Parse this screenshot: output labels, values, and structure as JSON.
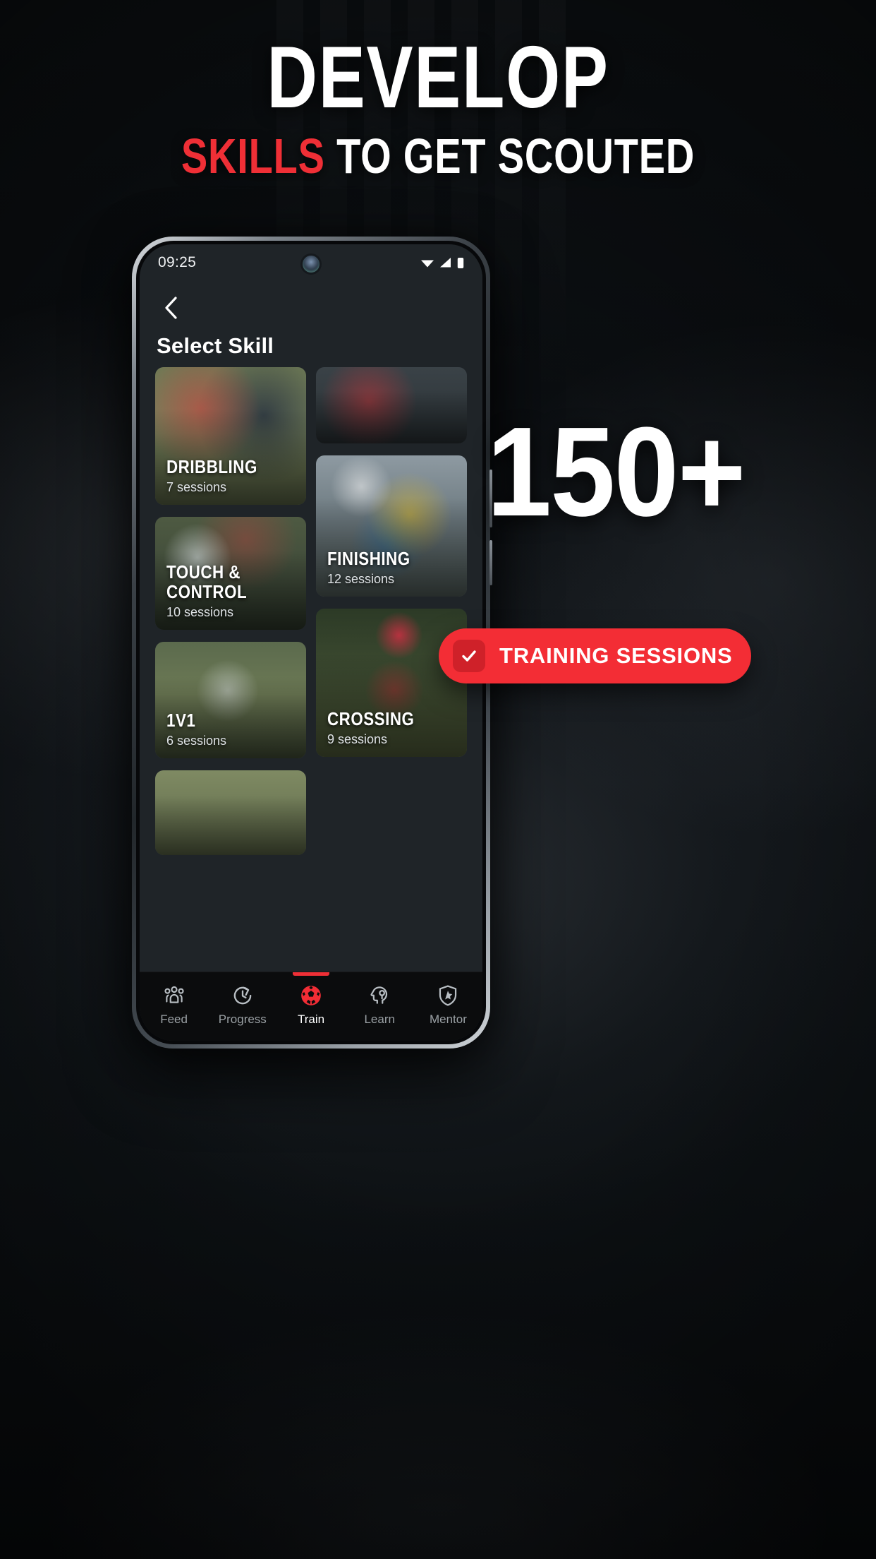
{
  "promo": {
    "headline": "DEVELOP",
    "subhead_highlight": "SKILLS",
    "subhead_rest": "TO GET SCOUTED",
    "accent_color": "#ef2f36",
    "stat_number": "150+",
    "badge_label": "TRAINING SESSIONS",
    "badge_color": "#f32d35"
  },
  "phone": {
    "status_bar": {
      "time": "09:25",
      "icons": [
        "wifi-icon",
        "signal-icon",
        "battery-icon"
      ]
    },
    "app": {
      "back_icon": "chevron-left-icon",
      "title": "Select Skill",
      "left_column": [
        {
          "title": "DRIBBLING",
          "sessions": "7 sessions",
          "art": "ph-dribbling"
        },
        {
          "title": "TOUCH &\nCONTROL",
          "sessions": "10 sessions",
          "art": "ph-touch"
        },
        {
          "title": "1V1",
          "sessions": "6 sessions",
          "art": "ph-1v1"
        },
        {
          "title": "",
          "sessions": "",
          "art": "ph-bottomleft"
        }
      ],
      "right_column": [
        {
          "title": "",
          "sessions": "",
          "art": "ph-top-right"
        },
        {
          "title": "FINISHING",
          "sessions": "12 sessions",
          "art": "ph-finishing"
        },
        {
          "title": "CROSSING",
          "sessions": "9 sessions",
          "art": "ph-crossing"
        }
      ],
      "nav": [
        {
          "label": "Feed",
          "icon": "people-group-icon",
          "active": false
        },
        {
          "label": "Progress",
          "icon": "clock-rotate-icon",
          "active": false
        },
        {
          "label": "Train",
          "icon": "soccer-ball-icon",
          "active": true
        },
        {
          "label": "Learn",
          "icon": "head-lightbulb-icon",
          "active": false
        },
        {
          "label": "Mentor",
          "icon": "shield-star-icon",
          "active": false
        }
      ]
    }
  }
}
